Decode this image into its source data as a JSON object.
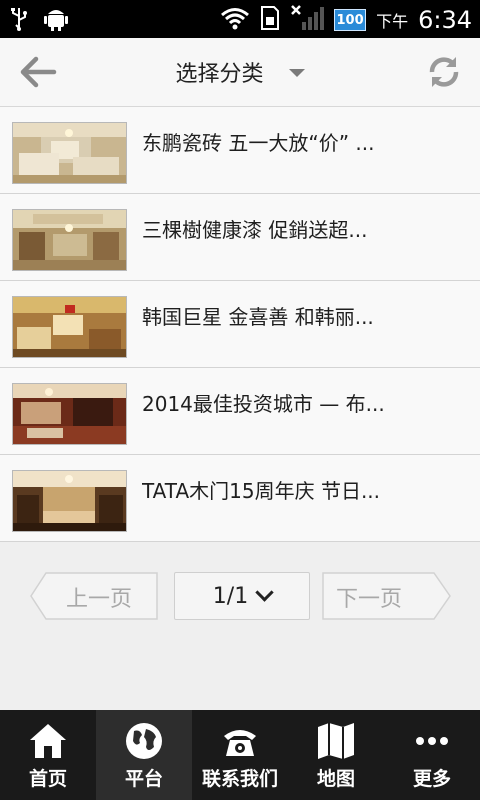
{
  "status_bar": {
    "time": "6:34",
    "ampm": "下午",
    "battery": "100"
  },
  "header": {
    "title": "选择分类"
  },
  "articles": [
    {
      "title": "东鹏瓷砖 五一大放“价” ..."
    },
    {
      "title": "三棵樹健康漆 促銷送超..."
    },
    {
      "title": "韩国巨星 金喜善 和韩丽..."
    },
    {
      "title": "2014最佳投资城市 — 布..."
    },
    {
      "title": "TATA木门15周年庆 节日..."
    }
  ],
  "pager": {
    "prev_label": "上一页",
    "page_value": "1/1",
    "next_label": "下一页"
  },
  "bottom_nav": {
    "items": [
      {
        "label": "首页",
        "icon": "home-icon"
      },
      {
        "label": "平台",
        "icon": "globe-icon"
      },
      {
        "label": "联系我们",
        "icon": "phone-icon"
      },
      {
        "label": "地图",
        "icon": "map-icon"
      },
      {
        "label": "更多",
        "icon": "more-icon"
      }
    ],
    "active_index": 1
  },
  "colors": {
    "header_bg": "#f7f7f7",
    "list_bg": "#f9f9f9",
    "nav_bg": "#1a1a1a",
    "nav_active_bg": "#2d2d2d"
  }
}
